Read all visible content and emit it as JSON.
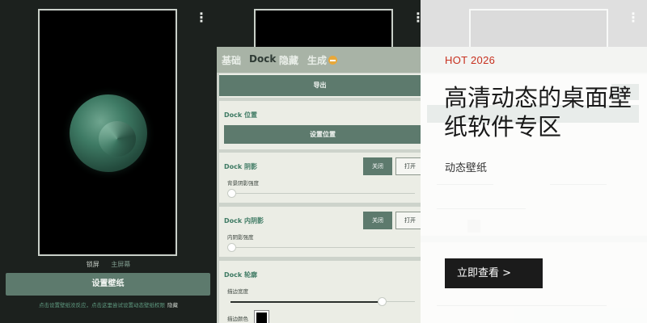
{
  "wallpaper_screen": {
    "menu_icon": "more-vert-icon",
    "tabs": [
      "锁屏",
      "主屏幕"
    ],
    "set_button": "设置壁纸",
    "hint": "点击设置壁纸没反应，点击这里尝试设置动态壁纸权限",
    "hide_link": "隐藏"
  },
  "dock_screen": {
    "tabs": [
      "基础",
      "Dock",
      "隐藏",
      "生成"
    ],
    "export_button": "导出",
    "dock_position": {
      "title": "Dock 位置",
      "button": "设置位置"
    },
    "dock_shadow": {
      "title": "Dock 阴影",
      "off": "关闭",
      "on": "打开",
      "slider_label": "背景阴影强度",
      "level": 0
    },
    "dock_inner_shadow": {
      "title": "Dock 内阴影",
      "off": "关闭",
      "on": "打开",
      "slider_label": "内阴影强度",
      "level": 0
    },
    "dock_outline": {
      "title": "Dock 轮廓",
      "width_label": "描边宽度",
      "width_level": 0.82,
      "color_label": "描边颜色",
      "color": "#000000"
    }
  },
  "ad": {
    "tag": "HOT 2026",
    "title": "高清动态的桌面壁纸软件专区",
    "subtitle": "动态壁纸",
    "cta": "立即查看 >"
  },
  "colors": {
    "accent_green": "#5d7a6d",
    "title_green": "#3e7a63",
    "badge_orange": "#e8a83a",
    "ad_red": "#c7301f"
  }
}
